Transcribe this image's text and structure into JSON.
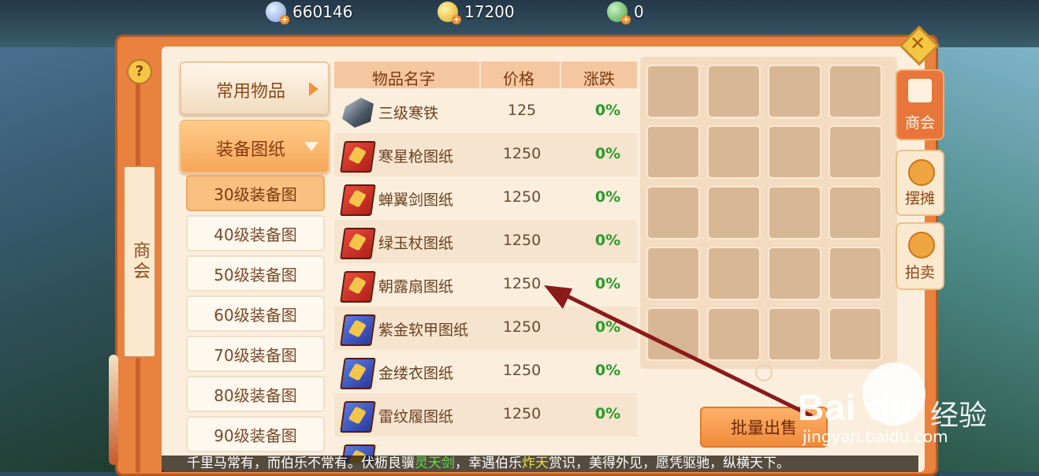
{
  "currency": {
    "silver": {
      "icon": "silver-coin-icon",
      "value": "660146"
    },
    "gold": {
      "icon": "gold-ingot-icon",
      "value": "17200"
    },
    "jade": {
      "icon": "jade-coin-icon",
      "value": "0"
    }
  },
  "left_rail": {
    "help": "?",
    "tag": "商会"
  },
  "categories": {
    "common": "常用物品",
    "equip": "装备图纸",
    "sub": [
      "30级装备图",
      "40级装备图",
      "50级装备图",
      "60级装备图",
      "70级装备图",
      "80级装备图",
      "90级装备图"
    ],
    "active_sub_index": 0
  },
  "table": {
    "headers": {
      "name": "物品名字",
      "price": "价格",
      "change": "涨跌"
    },
    "rows": [
      {
        "name": "三级寒铁",
        "price": "125",
        "change": "0%",
        "icon": "ore-icon"
      },
      {
        "name": "寒星枪图纸",
        "price": "1250",
        "change": "0%",
        "icon": "red-book-icon"
      },
      {
        "name": "蝉翼剑图纸",
        "price": "1250",
        "change": "0%",
        "icon": "red-book-icon"
      },
      {
        "name": "绿玉杖图纸",
        "price": "1250",
        "change": "0%",
        "icon": "red-book-icon"
      },
      {
        "name": "朝露扇图纸",
        "price": "1250",
        "change": "0%",
        "icon": "red-book-icon"
      },
      {
        "name": "紫金软甲图纸",
        "price": "1250",
        "change": "0%",
        "icon": "blue-book-icon"
      },
      {
        "name": "金缕衣图纸",
        "price": "1250",
        "change": "0%",
        "icon": "blue-book-icon"
      },
      {
        "name": "雷纹履图纸",
        "price": "1250",
        "change": "0%",
        "icon": "blue-book-icon"
      }
    ]
  },
  "inventory": {
    "rows": 5,
    "cols": 4
  },
  "buttons": {
    "batch_sell": "批量出售"
  },
  "side_tabs": {
    "guild": "商会",
    "stall": "摆摊",
    "auction": "拍卖"
  },
  "marquee": {
    "part1": "千里马常有，而伯乐不常有。伏枥良骥",
    "hl1": "灵天剑",
    "part2": "，幸遇伯乐",
    "hl2": "炸天",
    "part3": "赏识，美得外见，愿凭驱驰，纵横天下。"
  },
  "watermark": {
    "logo": "Bai du",
    "cn": "经验",
    "url": "jingyan.baidu.com"
  },
  "colors": {
    "accent": "#e9813f",
    "panel": "#fbeedc",
    "positive": "#2a9a2a",
    "annotation_arrow": "#8b1a1a"
  }
}
